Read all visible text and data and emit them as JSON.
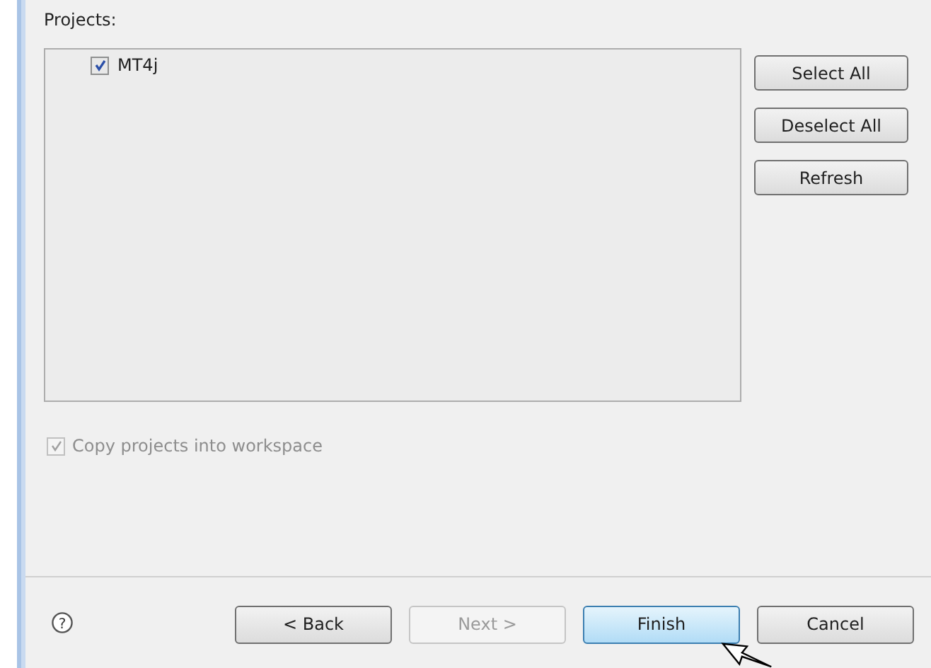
{
  "projects_label": "Projects:",
  "projects": [
    {
      "label": "MT4j",
      "checked": true
    }
  ],
  "side_buttons": [
    "Select All",
    "Deselect All",
    "Refresh"
  ],
  "copy_option": {
    "label": "Copy projects into workspace",
    "checked": true,
    "disabled": true
  },
  "help_glyph": "?",
  "buttons": [
    {
      "label": "< Back",
      "disabled": false,
      "focused": false
    },
    {
      "label": "Next >",
      "disabled": true,
      "focused": false
    },
    {
      "label": "Finish",
      "disabled": false,
      "focused": true
    },
    {
      "label": "Cancel",
      "disabled": false,
      "focused": false
    }
  ]
}
